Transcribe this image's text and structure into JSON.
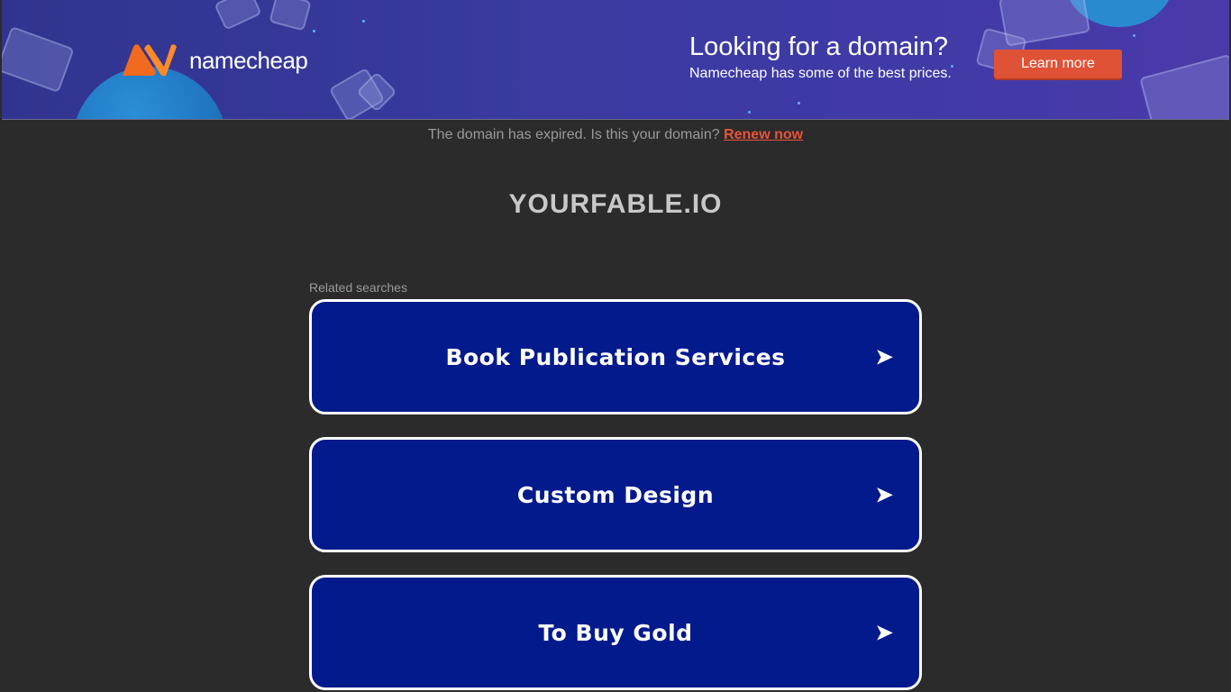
{
  "banner": {
    "brand": "namecheap",
    "promo_title": "Looking for a domain?",
    "promo_subtitle": "Namecheap has some of the best prices.",
    "learn_more_label": "Learn more",
    "accent_color": "#e05236"
  },
  "notice": {
    "text": "The domain has expired. Is this your domain?",
    "link_label": "Renew now"
  },
  "domain_name": "YOURFABLE.IO",
  "related": {
    "label": "Related searches",
    "items": [
      {
        "label": "Book Publication Services",
        "icon": "arrow-right-icon"
      },
      {
        "label": "Custom Design",
        "icon": "arrow-right-icon"
      },
      {
        "label": "To Buy Gold",
        "icon": "arrow-right-icon"
      }
    ]
  },
  "colors": {
    "page_bg": "#2b2b2b",
    "button_bg": "#021a8c",
    "link": "#e8533a"
  }
}
